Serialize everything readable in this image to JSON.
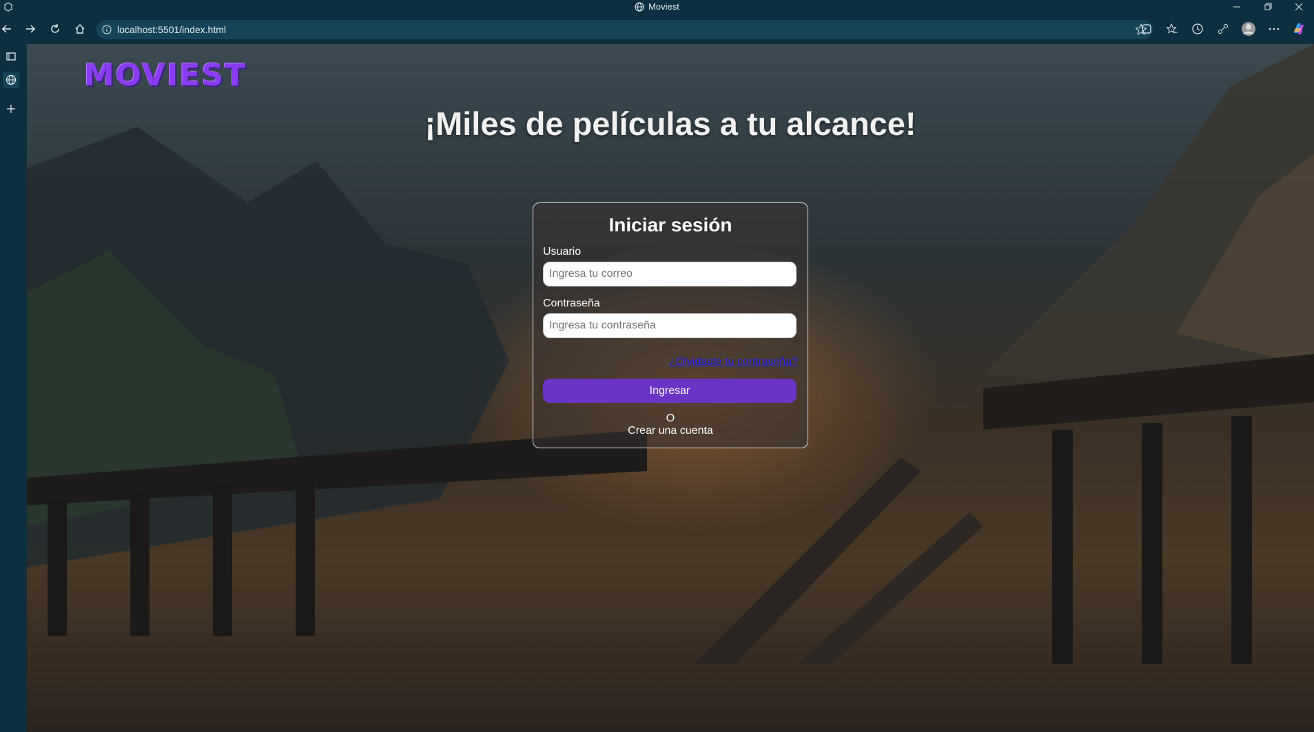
{
  "window": {
    "title": "Moviest"
  },
  "toolbar": {
    "url": "localhost:5501/index.html"
  },
  "colors": {
    "accent": "#6a35c4",
    "logo": "#8a3cf0",
    "link": "#1a1aff",
    "chrome": "#0d2f3f"
  },
  "icons": [
    "back-icon",
    "forward-icon",
    "refresh-icon",
    "home-icon",
    "info-icon",
    "star-icon",
    "extensions-icon",
    "favorites-icon",
    "history-icon",
    "share-icon",
    "profile-avatar",
    "more-icon",
    "copilot-icon",
    "tabs-icon",
    "globe-icon",
    "plus-icon"
  ],
  "page": {
    "logo": "MOVIEST",
    "headline": "¡Miles de películas a tu alcance!",
    "login": {
      "title": "Iniciar sesión",
      "user_label": "Usuario",
      "user_placeholder": "Ingresa tu correo",
      "password_label": "Contraseña",
      "password_placeholder": "Ingresa tu contraseña",
      "forgot_link": "¿Olvidaste tu contraseña?",
      "submit": "Ingresar",
      "or": "O",
      "create_account": "Crear una cuenta"
    }
  }
}
